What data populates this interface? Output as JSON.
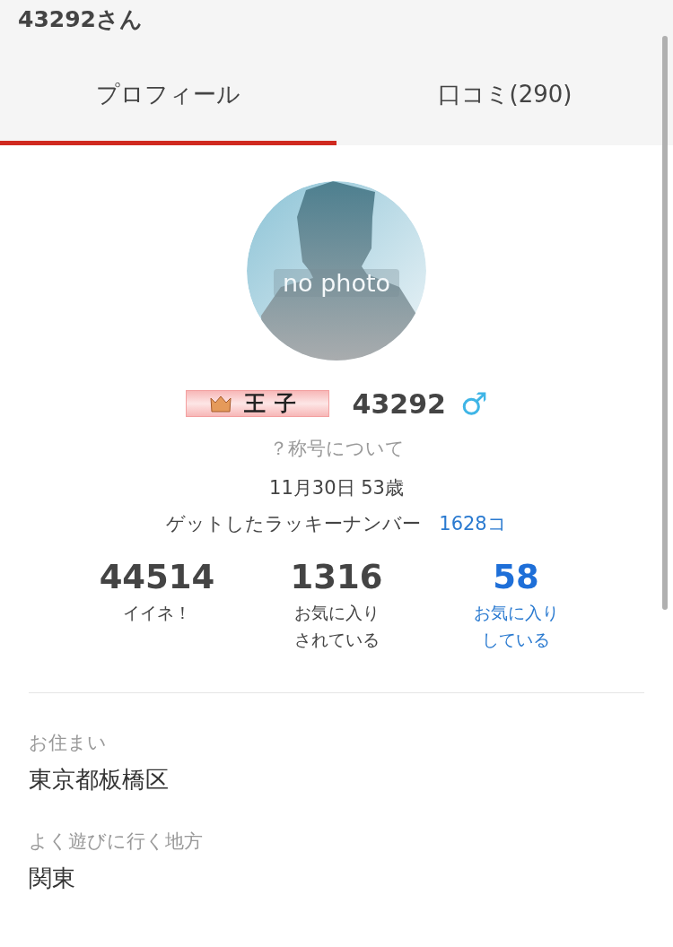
{
  "header": {
    "title": "43292さん"
  },
  "tabs": [
    {
      "label": "プロフィール",
      "selected": true
    },
    {
      "label": "口コミ(290)",
      "selected": false
    }
  ],
  "profile": {
    "avatar_text": "no photo",
    "badge": "王子",
    "name": "43292",
    "gender_symbol": "♂",
    "title_help": "？称号について",
    "birthday": "11月30日 53歳",
    "lucky_label": "ゲットしたラッキーナンバー",
    "lucky_count": "1628コ"
  },
  "stats": [
    {
      "value": "44514",
      "label": "イイネ！",
      "link": false
    },
    {
      "value": "1316",
      "label": "お気に入りされている",
      "link": false
    },
    {
      "value": "58",
      "label": "お気に入りしている",
      "link": true
    }
  ],
  "info": [
    {
      "label": "お住まい",
      "value": "東京都板橋区"
    },
    {
      "label": "よく遊びに行く地方",
      "value": "関東"
    }
  ]
}
